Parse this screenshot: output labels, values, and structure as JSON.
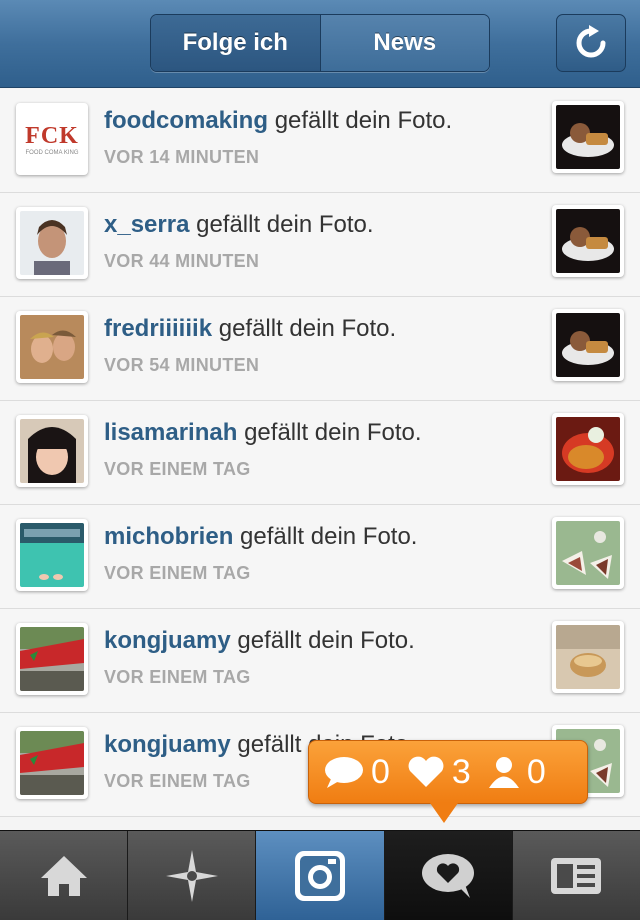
{
  "header": {
    "segments": [
      "Folge ich",
      "News"
    ],
    "active_segment": "News",
    "refresh_icon": "refresh-icon"
  },
  "notifications": [
    {
      "username": "foodcomaking",
      "action": "gefällt dein Foto.",
      "time": "VOR 14 MINUTEN",
      "avatar_text": "FCK",
      "avatar_subtext": "FOOD COMA KING"
    },
    {
      "username": "x_serra",
      "action": "gefällt dein Foto.",
      "time": "VOR 44 MINUTEN"
    },
    {
      "username": "fredriiiiiik",
      "action": "gefällt dein Foto.",
      "time": "VOR 54 MINUTEN"
    },
    {
      "username": "lisamarinah",
      "action": "gefällt dein Foto.",
      "time": "VOR EINEM TAG"
    },
    {
      "username": "michobrien",
      "action": "gefällt dein Foto.",
      "time": "VOR EINEM TAG"
    },
    {
      "username": "kongjuamy",
      "action": "gefällt dein Foto.",
      "time": "VOR EINEM TAG"
    },
    {
      "username": "kongjuamy",
      "action": "gefällt dein Foto.",
      "time": "VOR EINEM TAG"
    }
  ],
  "activity_bubble": {
    "comments": "0",
    "likes": "3",
    "followers": "0",
    "color": "#f68a1e"
  },
  "tabbar": {
    "tabs": [
      "home-icon",
      "explore-icon",
      "camera-icon",
      "news-icon",
      "profile-icon"
    ],
    "active": "news-icon"
  }
}
